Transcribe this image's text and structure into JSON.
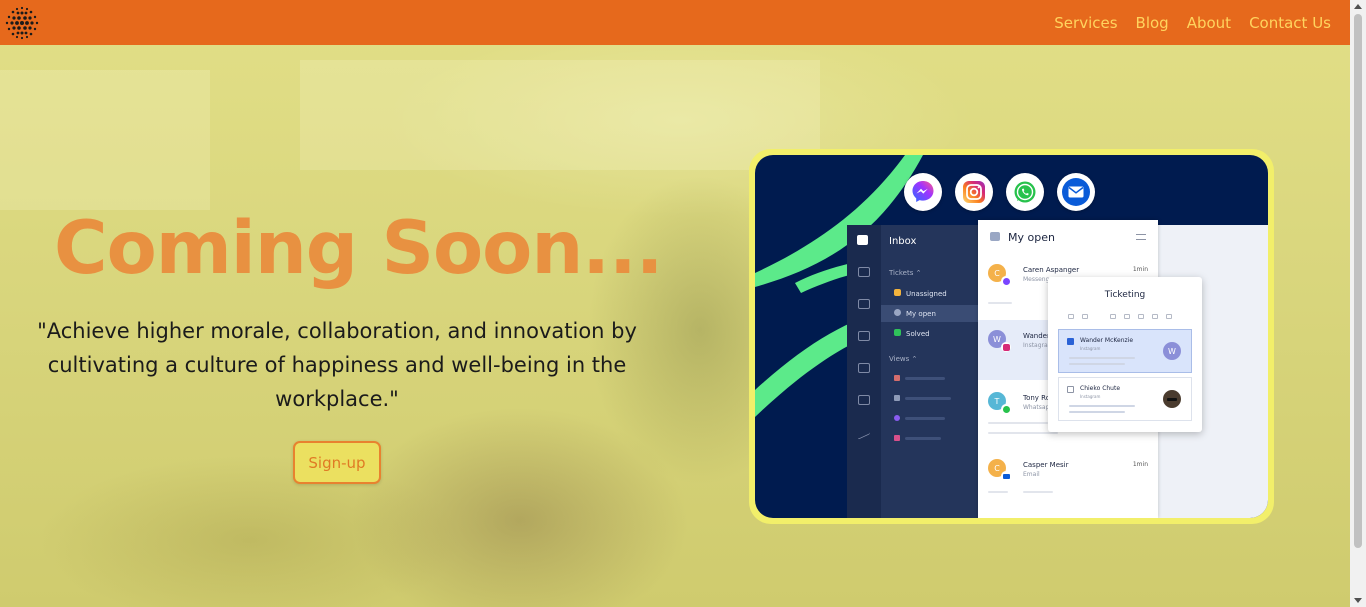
{
  "nav": {
    "logo_icon": "dotted-sphere-logo-icon",
    "items": [
      "Services",
      "Blog",
      "About",
      "Contact Us"
    ]
  },
  "hero": {
    "title": "Coming Soon...",
    "quote": "\"Achieve higher morale, collaboration, and innovation by cultivating a culture of happiness and well-being in the workplace.\"",
    "signup_label": "Sign-up"
  },
  "mock": {
    "channels": [
      "messenger-icon",
      "instagram-icon",
      "whatsapp-icon",
      "email-icon"
    ],
    "inbox": {
      "title": "Inbox",
      "tickets_section": "Tickets ⌃",
      "items": [
        "Unassigned",
        "My open",
        "Solved"
      ],
      "views_section": "Views ⌃"
    },
    "open": {
      "title": "My open",
      "conversations": [
        {
          "initial": "C",
          "name": "Caren Aspanger",
          "channel": "Messenger",
          "time": "1min",
          "color": "#f4b14a"
        },
        {
          "initial": "W",
          "name": "Wander McKenzie",
          "channel": "Instagram",
          "time": "",
          "color": "#8b8fd8"
        },
        {
          "initial": "T",
          "name": "Tony Robinson",
          "channel": "Whatsapp",
          "time": "",
          "color": "#56b7d6"
        },
        {
          "initial": "C",
          "name": "Casper Mesir",
          "channel": "Email",
          "time": "1min",
          "color": "#f4b14a"
        }
      ]
    },
    "ticketing": {
      "title": "Ticketing",
      "rows": [
        {
          "name": "Wander McKenzie",
          "channel": "Instagram",
          "avatar": "W"
        },
        {
          "name": "Chieko Chute",
          "channel": "Instagram",
          "avatar": ""
        }
      ]
    }
  },
  "colors": {
    "header": "#e6691c",
    "nav_text": "#ffd45e",
    "title": "#e89141"
  }
}
